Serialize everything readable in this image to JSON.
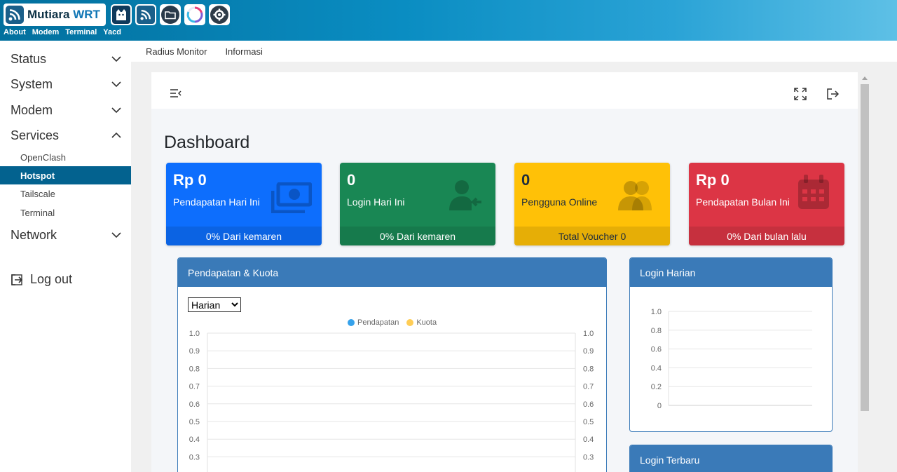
{
  "header": {
    "logo_text": "Mutiara",
    "logo_text_accent": "WRT",
    "links": [
      "About",
      "Modem",
      "Terminal",
      "Yacd"
    ]
  },
  "sidebar": {
    "items": [
      {
        "label": "Status",
        "expanded": false
      },
      {
        "label": "System",
        "expanded": false
      },
      {
        "label": "Modem",
        "expanded": false
      },
      {
        "label": "Services",
        "expanded": true
      },
      {
        "label": "Network",
        "expanded": false
      }
    ],
    "services_sub": [
      {
        "label": "OpenClash",
        "active": false
      },
      {
        "label": "Hotspot",
        "active": true
      },
      {
        "label": "Tailscale",
        "active": false
      },
      {
        "label": "Terminal",
        "active": false
      }
    ],
    "logout": "Log out"
  },
  "tabs": [
    "Radius Monitor",
    "Informasi"
  ],
  "dashboard": {
    "title": "Dashboard",
    "boxes": [
      {
        "value": "Rp 0",
        "label": "Pendapatan Hari Ini",
        "footer": "0% Dari kemaren",
        "color": "#0d6efd",
        "foot_color": "#0b63e3",
        "text": "#fff",
        "icon": "money-bill-icon"
      },
      {
        "value": "0",
        "label": "Login Hari Ini",
        "footer": "0% Dari kemaren",
        "color": "#198754",
        "foot_color": "#167a4c",
        "text": "#fff",
        "icon": "user-login-icon"
      },
      {
        "value": "0",
        "label": "Pengguna Online",
        "footer": "Total Voucher 0",
        "color": "#ffc107",
        "foot_color": "#e6ae06",
        "text": "#1f2d3d",
        "icon": "users-icon"
      },
      {
        "value": "Rp 0",
        "label": "Pendapatan Bulan Ini",
        "footer": "0% Dari bulan lalu",
        "color": "#dc3545",
        "foot_color": "#c6303e",
        "text": "#fff",
        "icon": "calendar-icon"
      }
    ],
    "revenue_card": {
      "title": "Pendapatan & Kuota",
      "select_value": "Harian",
      "legend": [
        {
          "label": "Pendapatan",
          "color": "#36a2eb"
        },
        {
          "label": "Kuota",
          "color": "#ffcd56"
        }
      ]
    },
    "login_card": {
      "title": "Login Harian"
    },
    "latest_card": {
      "title": "Login Terbaru"
    }
  },
  "chart_data": [
    {
      "type": "line",
      "title": "",
      "series": [
        {
          "name": "Pendapatan",
          "values": []
        },
        {
          "name": "Kuota",
          "values": []
        }
      ],
      "y_ticks": [
        "1.0",
        "0.9",
        "0.8",
        "0.7",
        "0.6",
        "0.5",
        "0.4",
        "0.3"
      ],
      "y2_ticks": [
        "1.0",
        "0.9",
        "0.8",
        "0.7",
        "0.6",
        "0.5",
        "0.4",
        "0.3"
      ],
      "ylim": [
        0,
        1
      ],
      "grid": true,
      "legend": "top-center"
    },
    {
      "type": "bar",
      "title": "",
      "series": [],
      "y_ticks": [
        "1.0",
        "0.8",
        "0.6",
        "0.4",
        "0.2",
        "0"
      ],
      "ylim": [
        0,
        1
      ],
      "grid": true
    }
  ]
}
